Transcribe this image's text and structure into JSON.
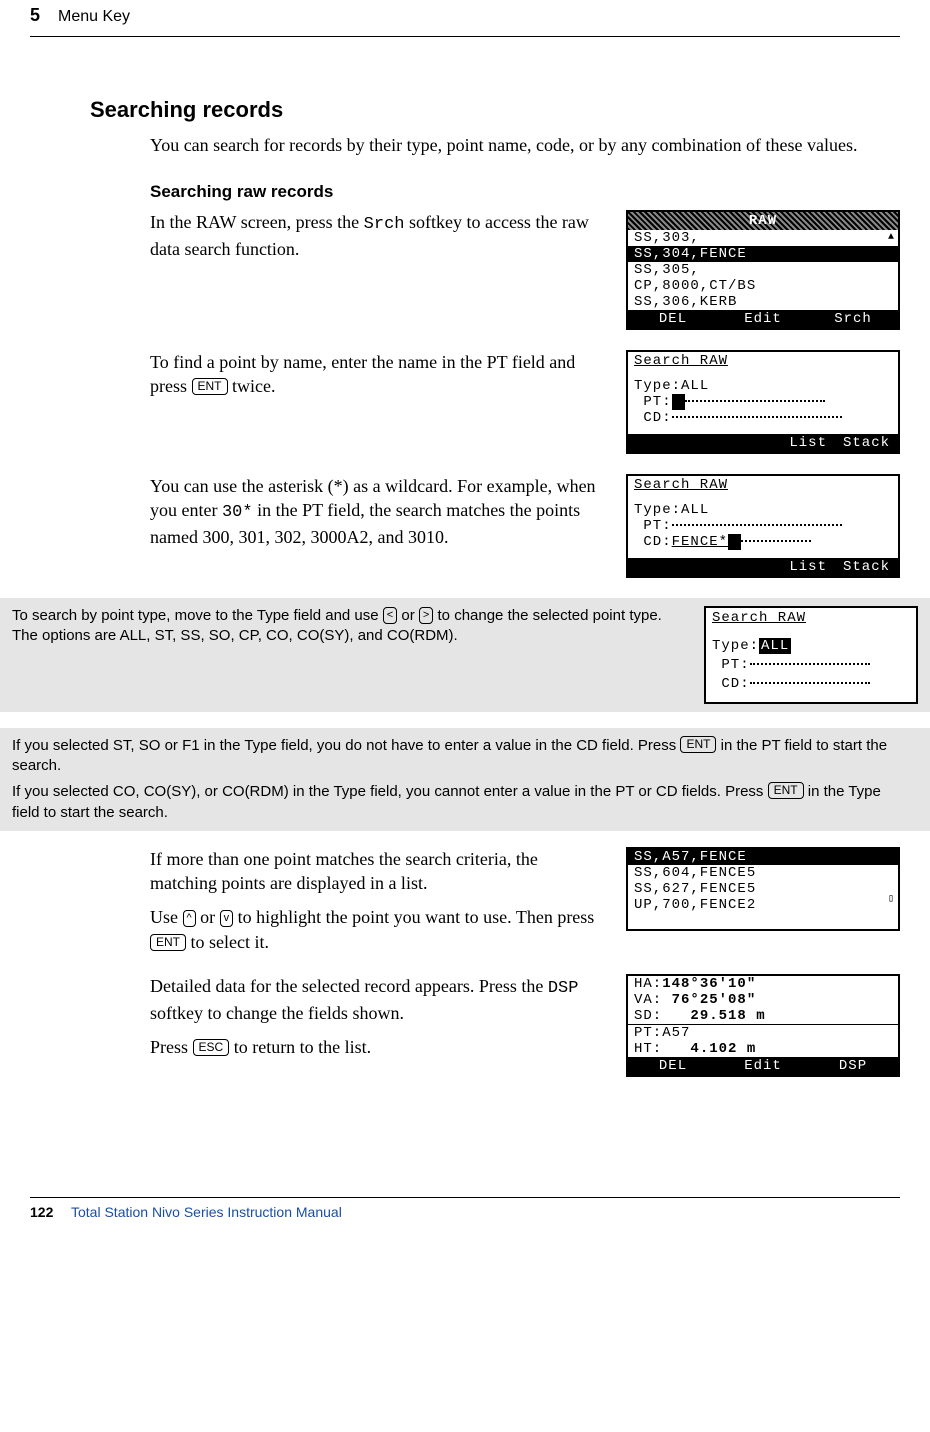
{
  "header": {
    "chapter": "5",
    "title": "Menu Key"
  },
  "section": {
    "title": "Searching records"
  },
  "intro": "You can search for records by their type, point name, code, or by any combination of these values.",
  "sub": {
    "title": "Searching raw records"
  },
  "p1": {
    "pre": "In the RAW screen, press the ",
    "mono": "Srch",
    "post": " softkey to access the raw data search function."
  },
  "p2": {
    "pre": "To find a point by name, enter the name in the PT field and press ",
    "key": "ENT",
    "post": " twice."
  },
  "p3": {
    "pre": "You can use the asterisk (*) as a wildcard. For example, when you enter ",
    "mono": "30*",
    "post": " in the PT field, the search matches the points named 300, 301, 302, 3000A2, and 3010."
  },
  "note1": {
    "pre": "To search by point type, move to the Type field and use ",
    "k1": "<",
    "mid": " or ",
    "k2": ">",
    "post": " to change the selected point type. The options are ALL, ST, SS, SO, CP, CO, CO(SY), and CO(RDM)."
  },
  "note2a": {
    "pre": "If you selected ST, SO or F1 in the Type field, you do not have to enter a value in the CD field. Press ",
    "key": "ENT",
    "post": " in the PT field to start the search."
  },
  "note2b": {
    "pre": "If you selected CO, CO(SY), or CO(RDM) in the Type field, you cannot enter a value in the PT or CD fields. Press ",
    "key": "ENT",
    "post": " in the Type field to start the search."
  },
  "p4": "If more than one point matches the search criteria, the matching points are displayed in a list.",
  "p5": {
    "pre": "Use ",
    "k1": "^",
    "mid1": " or ",
    "k2": "v",
    "mid2": " to highlight the point you want to use. Then press ",
    "key": "ENT",
    "post": " to select it."
  },
  "p6": {
    "pre": "Detailed data for the selected record appears. Press the ",
    "mono": "DSP",
    "post": " softkey to change the fields shown."
  },
  "p7": {
    "pre": "Press ",
    "key": "ESC",
    "post": " to return to the list."
  },
  "footer": {
    "page": "122",
    "manual": "Total Station Nivo Series Instruction Manual"
  },
  "lcd1": {
    "title": "RAW",
    "lines": [
      "SS,303,",
      "SS,304,FENCE",
      "SS,305,",
      "CP,8000,CT/BS",
      "SS,306,KERB"
    ],
    "soft": [
      "DEL",
      "Edit",
      "Srch"
    ]
  },
  "lcd2": {
    "title": "Search RAW",
    "type_lbl": "Type:",
    "type_val": "ALL",
    "pt_lbl": " PT:",
    "cd_lbl": " CD:",
    "soft": [
      "List",
      "Stack"
    ]
  },
  "lcd3": {
    "title": "Search RAW",
    "type_lbl": "Type:",
    "type_val": "ALL",
    "pt_lbl": " PT:",
    "cd_lbl": " CD:",
    "cd_val": "FENCE*",
    "soft": [
      "List",
      "Stack"
    ]
  },
  "lcd4": {
    "title": "Search RAW",
    "type_lbl": "Type:",
    "type_val": "ALL",
    "pt_lbl": " PT:",
    "cd_lbl": " CD:"
  },
  "lcd5": {
    "lines": [
      "SS,A57,FENCE",
      "SS,604,FENCE5",
      "SS,627,FENCE5",
      "UP,700,FENCE2"
    ]
  },
  "lcd6": {
    "ha_lbl": "HA:",
    "ha_val": "148°36'10\"",
    "va_lbl": "VA:",
    "va_val": " 76°25'08\"",
    "sd_lbl": "SD:",
    "sd_val": "   29.518 m",
    "pt_lbl": "PT:",
    "pt_val": "A57",
    "ht_lbl": "HT:",
    "ht_val": "   4.102 m",
    "soft": [
      "DEL",
      "Edit",
      "DSP"
    ]
  }
}
